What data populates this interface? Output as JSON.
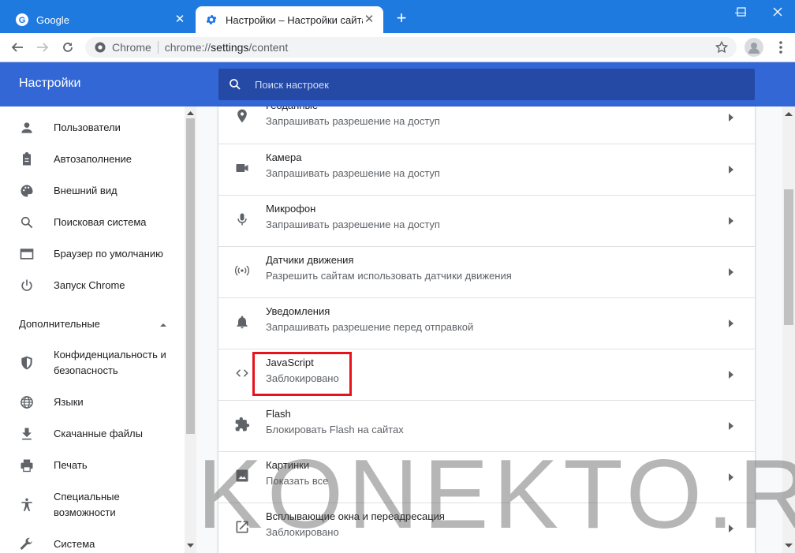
{
  "tabs": [
    {
      "title": "Google",
      "active": false,
      "icon": "google-g-icon"
    },
    {
      "title": "Настройки – Настройки сайта",
      "active": true,
      "icon": "gear-icon"
    }
  ],
  "address_bar": {
    "origin_label": "Chrome",
    "url_scheme": "chrome://",
    "url_host": "settings",
    "url_path": "/content"
  },
  "header": {
    "title": "Настройки",
    "search_placeholder": "Поиск настроек"
  },
  "sidebar": {
    "items": [
      {
        "label": "Пользователи",
        "icon": "person-icon"
      },
      {
        "label": "Автозаполнение",
        "icon": "clipboard-icon"
      },
      {
        "label": "Внешний вид",
        "icon": "palette-icon"
      },
      {
        "label": "Поисковая система",
        "icon": "search-icon"
      },
      {
        "label": "Браузер по умолчанию",
        "icon": "browser-window-icon"
      },
      {
        "label": "Запуск Chrome",
        "icon": "power-icon"
      }
    ],
    "advanced_label": "Дополнительные",
    "advanced_items": [
      {
        "label_line1": "Конфиденциальность и",
        "label_line2": "безопасность",
        "icon": "shield-icon"
      },
      {
        "label_line1": "Языки",
        "label_line2": "",
        "icon": "globe-icon"
      },
      {
        "label_line1": "Скачанные файлы",
        "label_line2": "",
        "icon": "download-icon"
      },
      {
        "label_line1": "Печать",
        "label_line2": "",
        "icon": "printer-icon"
      },
      {
        "label_line1": "Специальные",
        "label_line2": "возможности",
        "icon": "accessibility-icon"
      },
      {
        "label_line1": "Система",
        "label_line2": "",
        "icon": "wrench-icon"
      }
    ]
  },
  "content_rows": [
    {
      "title": "Геоданные",
      "subtitle": "Запрашивать разрешение на доступ",
      "icon": "location-pin-icon"
    },
    {
      "title": "Камера",
      "subtitle": "Запрашивать разрешение на доступ",
      "icon": "camera-icon"
    },
    {
      "title": "Микрофон",
      "subtitle": "Запрашивать разрешение на доступ",
      "icon": "microphone-icon"
    },
    {
      "title": "Датчики движения",
      "subtitle": "Разрешить сайтам использовать датчики движения",
      "icon": "motion-sensor-icon"
    },
    {
      "title": "Уведомления",
      "subtitle": "Запрашивать разрешение перед отправкой",
      "icon": "bell-icon"
    },
    {
      "title": "JavaScript",
      "subtitle": "Заблокировано",
      "icon": "code-icon",
      "highlighted": true
    },
    {
      "title": "Flash",
      "subtitle": "Блокировать Flash на сайтах",
      "icon": "puzzle-icon"
    },
    {
      "title": "Картинки",
      "subtitle": "Показать все",
      "icon": "image-icon"
    },
    {
      "title": "Всплывающие окна и переадресация",
      "subtitle": "Заблокировано",
      "icon": "open-in-new-icon"
    }
  ],
  "watermark": "KONEKTO.RU",
  "colors": {
    "tabstrip": "#1f7ae0",
    "header": "#3367d6",
    "search_bg": "#254aa5",
    "highlight": "#e8121b",
    "icon": "#5f6368"
  }
}
